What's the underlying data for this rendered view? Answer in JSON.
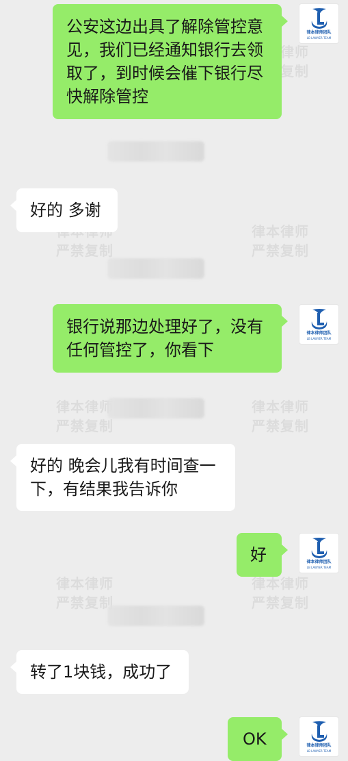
{
  "avatar": {
    "logo_cn": "律本律师团队",
    "logo_en": "LB LAWYER TEAM"
  },
  "watermark": {
    "line1": "律本律师",
    "line2": "严禁复制"
  },
  "messages": [
    {
      "from": "self",
      "text": "公安这边出具了解除管控意见，我们已经通知银行去领取了，到时候会催下银行尽快解除管控"
    },
    {
      "from": "other",
      "text": "好的 多谢"
    },
    {
      "from": "self",
      "text": "银行说那边处理好了，没有任何管控了，你看下"
    },
    {
      "from": "other",
      "text": "好的 晚会儿我有时间查一下，有结果我告诉你"
    },
    {
      "from": "self",
      "text": "好"
    },
    {
      "from": "other",
      "text": "转了1块钱，成功了"
    },
    {
      "from": "self",
      "text": "OK"
    }
  ],
  "colors": {
    "background": "#ededed",
    "self_bubble": "#95ec69",
    "other_bubble": "#ffffff",
    "logo_blue": "#1f5fb0"
  }
}
